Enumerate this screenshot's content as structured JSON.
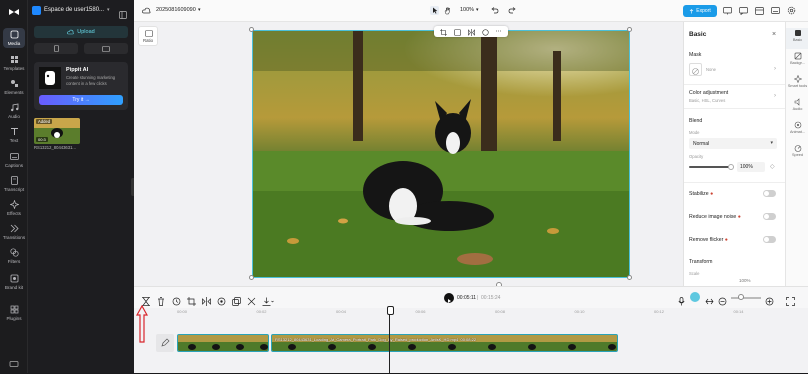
{
  "project": {
    "workspace": "Espace de user1580...",
    "name": "2025081609090",
    "zoom": "100%",
    "export_label": "Export"
  },
  "rail": [
    {
      "label": "Media",
      "icon": "media-icon",
      "active": true
    },
    {
      "label": "Templates",
      "icon": "templates-icon"
    },
    {
      "label": "Elements",
      "icon": "elements-icon"
    },
    {
      "label": "Audio",
      "icon": "audio-icon"
    },
    {
      "label": "Text",
      "icon": "text-icon"
    },
    {
      "label": "Captions",
      "icon": "captions-icon"
    },
    {
      "label": "Transcript",
      "icon": "transcript-icon"
    },
    {
      "label": "Effects",
      "icon": "effects-icon"
    },
    {
      "label": "Transitions",
      "icon": "transitions-icon"
    },
    {
      "label": "Filters",
      "icon": "filters-icon"
    },
    {
      "label": "Brand kit",
      "icon": "brand-kit-icon"
    },
    {
      "label": "Plugins",
      "icon": "plugins-icon"
    }
  ],
  "media": {
    "upload_label": "Upload",
    "pippit": {
      "title": "Pippit AI",
      "subtitle": "Create stunning marketing content in a few clicks",
      "try_label": "Try it →"
    },
    "asset": {
      "added": "Added",
      "duration": "00:3",
      "name": "RS13212_80443631..."
    }
  },
  "canvas": {
    "ratio_label": "Ratio"
  },
  "props": {
    "title": "Basic",
    "mask": {
      "label": "Mask",
      "value": "None"
    },
    "color": {
      "label": "Color adjustment",
      "sub": "Basic, HSL, Curves"
    },
    "blend": {
      "label": "Blend",
      "mode_label": "Mode",
      "mode_value": "Normal",
      "opacity_label": "Opacity",
      "opacity_value": "100%"
    },
    "stabilize": "Stabilize",
    "noise": "Reduce image noise",
    "flicker": "Remove flicker",
    "transform": "Transform",
    "scale_label": "Scale",
    "scale_value": "100%"
  },
  "right_tabs": [
    {
      "label": "Basic",
      "icon": "basic-icon",
      "active": true
    },
    {
      "label": "Backgr...",
      "icon": "background-icon"
    },
    {
      "label": "Smart tools",
      "icon": "smart-tools-icon"
    },
    {
      "label": "Audio",
      "icon": "audio-icon"
    },
    {
      "label": "Animat...",
      "icon": "animation-icon"
    },
    {
      "label": "Speed",
      "icon": "speed-icon"
    }
  ],
  "timeline": {
    "current": "00:05:11",
    "total": "00:15:24",
    "ticks": [
      "00:00",
      "00:02",
      "00:04",
      "00:06",
      "00:08",
      "00:10",
      "00:12",
      "00:14"
    ],
    "clip_label": "RS13212_80443631_Loading_At_Camera_Portrait_Park_Dog_By_Raised_production_ArtIsK_HD.mp4",
    "clip_duration": "00:08:22"
  },
  "colors": {
    "accent": "#1a9be8",
    "selection": "#4ac0d8",
    "annotation_arrow": "#d9262c"
  }
}
